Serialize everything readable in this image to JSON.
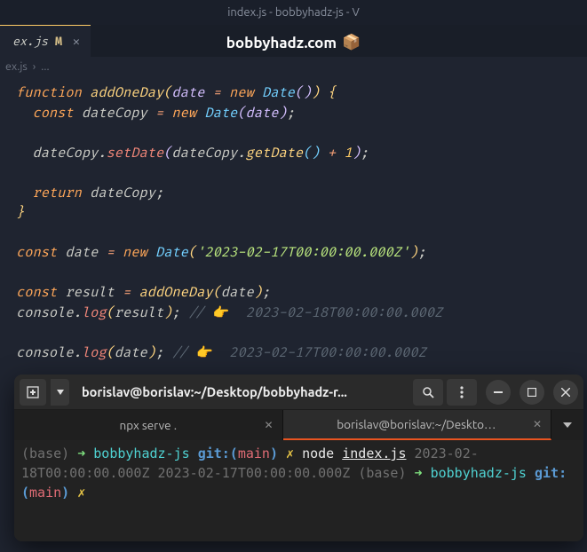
{
  "window": {
    "title": "index.js - bobbyhadz-js - V"
  },
  "tab": {
    "file": "ex.js",
    "status": "M"
  },
  "watermark": {
    "text": "bobbyhadz.com",
    "emoji": "📦"
  },
  "breadcrumb": {
    "file": "ex.js",
    "sep": "›",
    "more": "..."
  },
  "code": {
    "fn_kw": "function",
    "fn_name": "addOneDay",
    "param": "date",
    "eq": "=",
    "new_kw": "new",
    "date_type": "Date",
    "const_kw": "const",
    "datecopy": "dateCopy",
    "setdate": "setDate",
    "getdate": "getDate",
    "plus": "+",
    "one": "1",
    "return_kw": "return",
    "date_id": "date",
    "date_str": "'2023-02-17T00:00:00.000Z'",
    "result": "result",
    "console": "console",
    "log": "log",
    "cmt1": "// ",
    "emoji": "👉",
    "cmt1_tail": "  2023-02-18T00:00:00.000Z",
    "cmt2_tail": "  2023-02-17T00:00:00.000Z"
  },
  "terminal": {
    "title": "borislav@borislav:~/Desktop/bobbyhadz-r...",
    "tabs": [
      {
        "label": "npx serve ."
      },
      {
        "label": "borislav@borislav:~/Desktop/b..."
      }
    ],
    "prompt": {
      "base": "(base)",
      "arrow": "➜",
      "dir": "bobbyhadz-js",
      "git_lbl": "git:(",
      "branch": "main",
      "git_close": ")",
      "symbol": "✗",
      "cmd": "node",
      "arg": "index.js"
    },
    "out1": "2023-02-18T00:00:00.000Z",
    "out2": "2023-02-17T00:00:00.000Z"
  }
}
